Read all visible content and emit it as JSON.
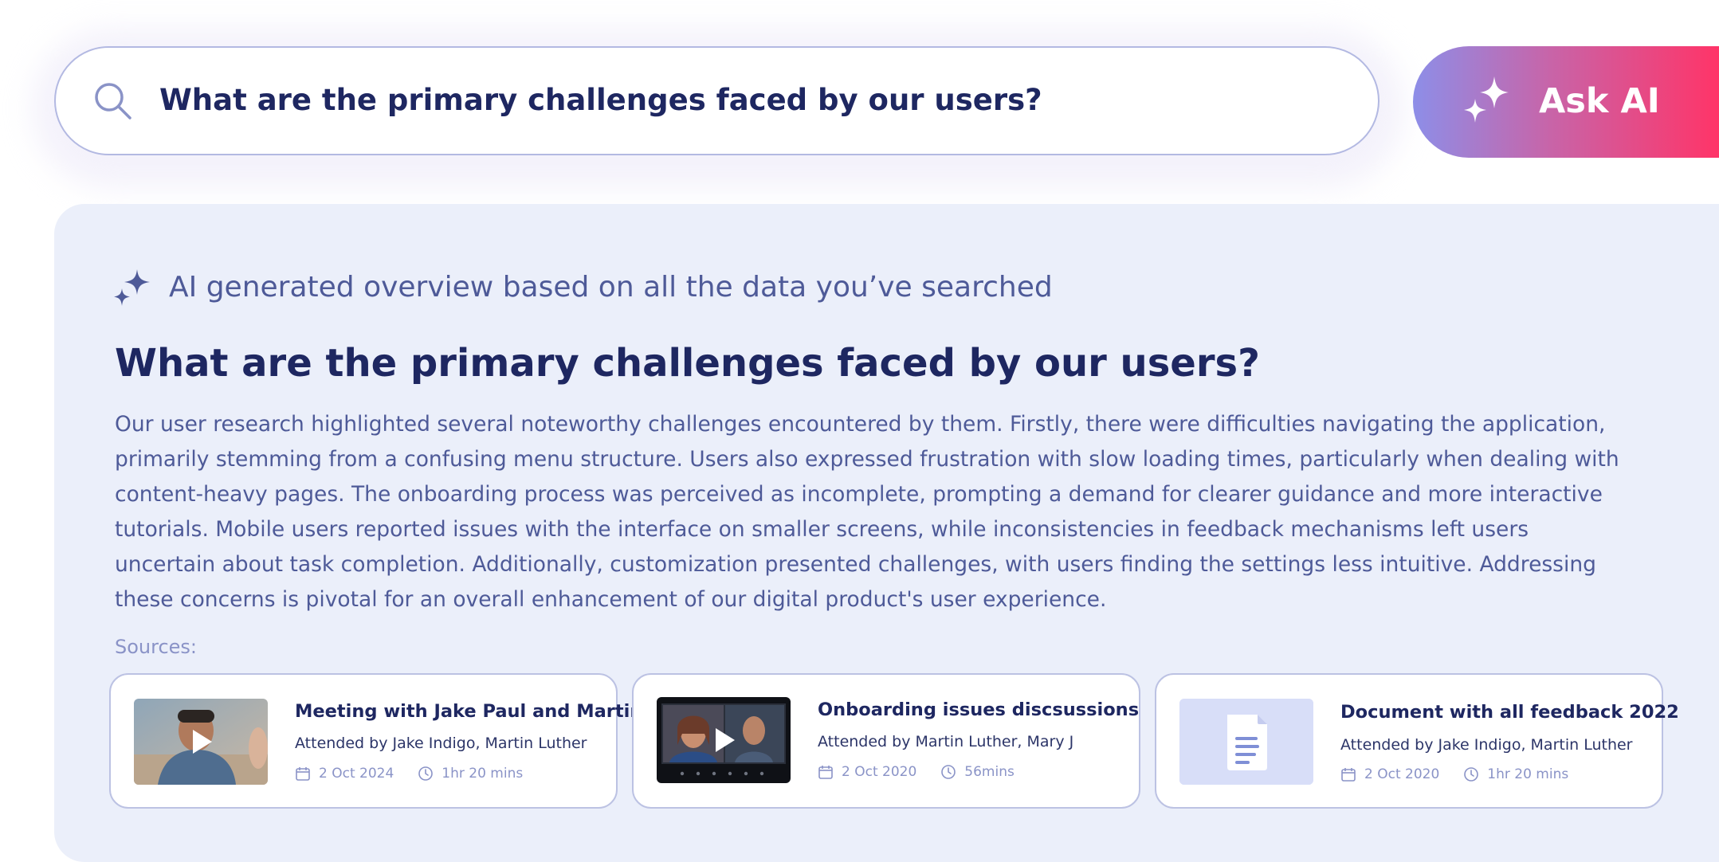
{
  "search": {
    "query": "What are the primary challenges faced by our users?",
    "icon": "search-icon"
  },
  "ask_ai": {
    "label": "Ask AI",
    "icon": "sparkle-icon"
  },
  "overview": {
    "label": "AI generated overview based on all the data you’ve searched",
    "title": "What are the primary challenges faced by our users?",
    "body": "Our user research highlighted several noteworthy challenges encountered by them. Firstly, there were difficulties navigating the application, primarily stemming from a confusing menu structure. Users also expressed frustration with slow loading times, particularly when dealing with content-heavy pages. The onboarding process was perceived as incomplete, prompting a demand for clearer guidance and more interactive tutorials. Mobile users reported issues with the interface on smaller screens, while inconsistencies in feedback mechanisms left users uncertain about task completion. Additionally, customization presented challenges, with users finding the settings less intuitive. Addressing these concerns is pivotal for an overall enhancement of our digital product's user experience.",
    "sources_label": "Sources:"
  },
  "sources": [
    {
      "type": "video",
      "title": "Meeting with Jake Paul and Martin",
      "attendees": "Attended by Jake Indigo, Martin Luther",
      "date": "2 Oct 2024",
      "duration": "1hr 20 mins"
    },
    {
      "type": "video",
      "title": "Onboarding issues discsussions",
      "attendees": "Attended by Martin Luther,  Mary J",
      "date": "2 Oct 2020",
      "duration": "56mins"
    },
    {
      "type": "document",
      "title": "Document with all feedback 2022",
      "attendees": "Attended by Jake Indigo, Martin Luther",
      "date": "2 Oct 2020",
      "duration": "1hr 20 mins"
    }
  ],
  "colors": {
    "primary_text": "#1e2761",
    "secondary_text": "#4e5a98",
    "panel_bg": "#ebeffa",
    "gradient_start": "#8d8ee8",
    "gradient_end": "#ff3468"
  }
}
